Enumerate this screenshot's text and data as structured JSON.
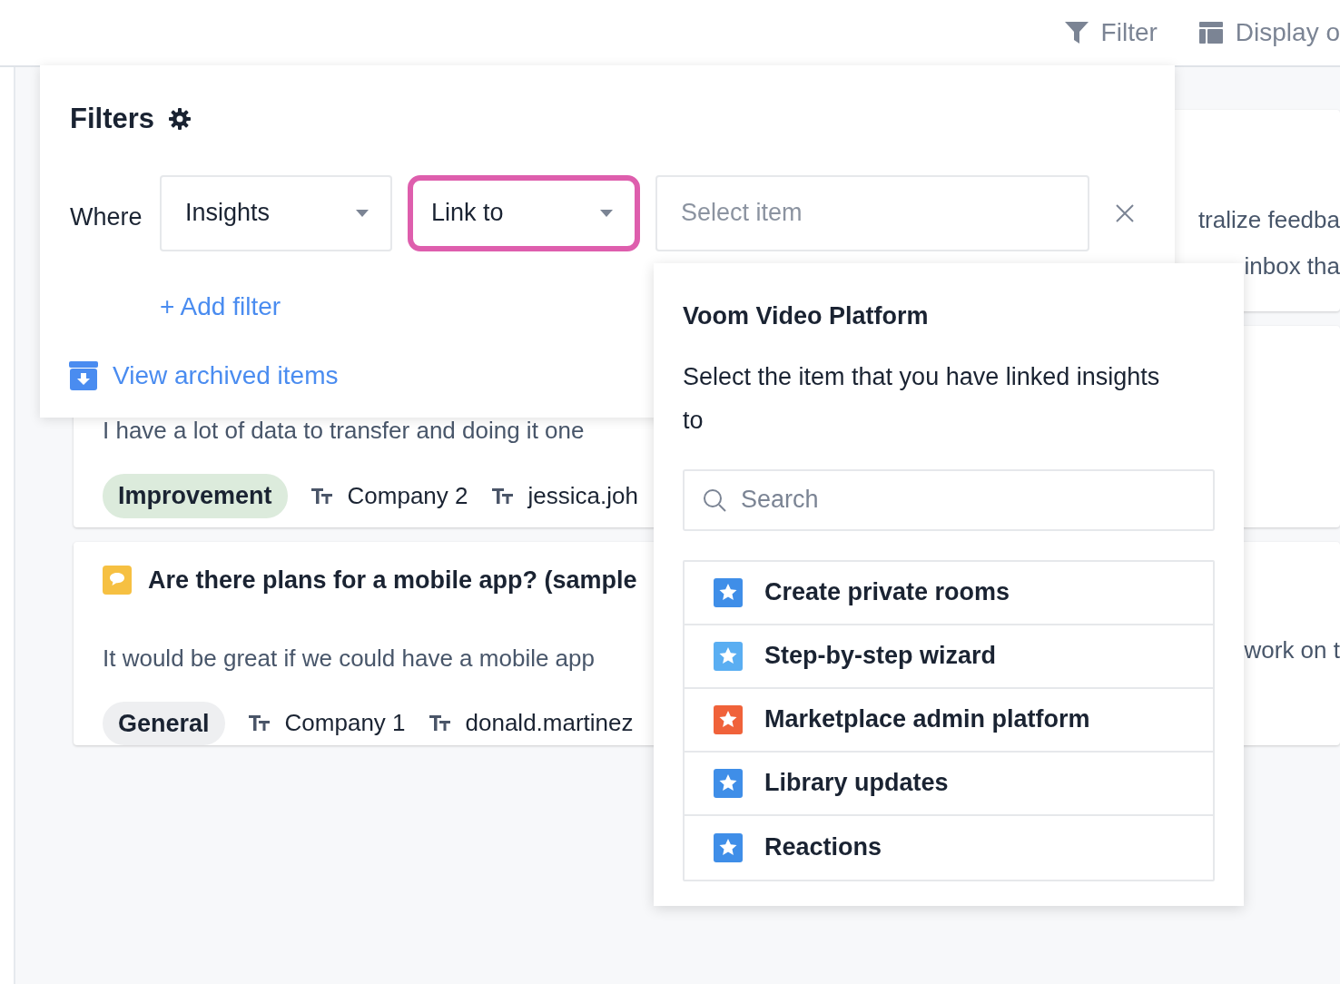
{
  "toolbar": {
    "buttons": [
      {
        "label": "Filter",
        "kind": "filter"
      },
      {
        "label": "Display o",
        "kind": "display"
      }
    ]
  },
  "cards": [
    {
      "right_lines": [
        "tralize feedba",
        "inbox tha"
      ]
    },
    {
      "body": "I have a lot of data to transfer and doing it one",
      "tags": [
        {
          "label": "Improvement",
          "color": "#dcebdc"
        }
      ],
      "fields": [
        "Company 2",
        "jessica.joh"
      ]
    },
    {
      "title": "Are there plans for a mobile app? (sample",
      "body": "It would be great if we could have a mobile app",
      "right_lines": [
        "work on t"
      ],
      "tags": [
        {
          "label": "General",
          "color": "#eeeff1"
        }
      ],
      "fields": [
        "Company 1",
        "donald.martinez"
      ]
    }
  ],
  "filters": {
    "title": "Filters",
    "where_label": "Where",
    "selects": [
      {
        "value": "Insights",
        "highlighted": false
      },
      {
        "value": "Link to",
        "highlighted": true
      }
    ],
    "item_field": {
      "placeholder": "Select item"
    },
    "add_filter": "+ Add filter",
    "archive_link": "View archived items"
  },
  "dropdown": {
    "title": "Voom Video Platform",
    "description": "Select the item that you have linked insights to",
    "search": {
      "placeholder": "Search"
    },
    "items": [
      {
        "label": "Create private rooms",
        "color": "#3f8ee8"
      },
      {
        "label": "Step-by-step wizard",
        "color": "#5aaef2"
      },
      {
        "label": "Marketplace admin platform",
        "color": "#f0623a"
      },
      {
        "label": "Library updates",
        "color": "#3f8ee8"
      },
      {
        "label": "Reactions",
        "color": "#3f8ee8"
      }
    ]
  }
}
